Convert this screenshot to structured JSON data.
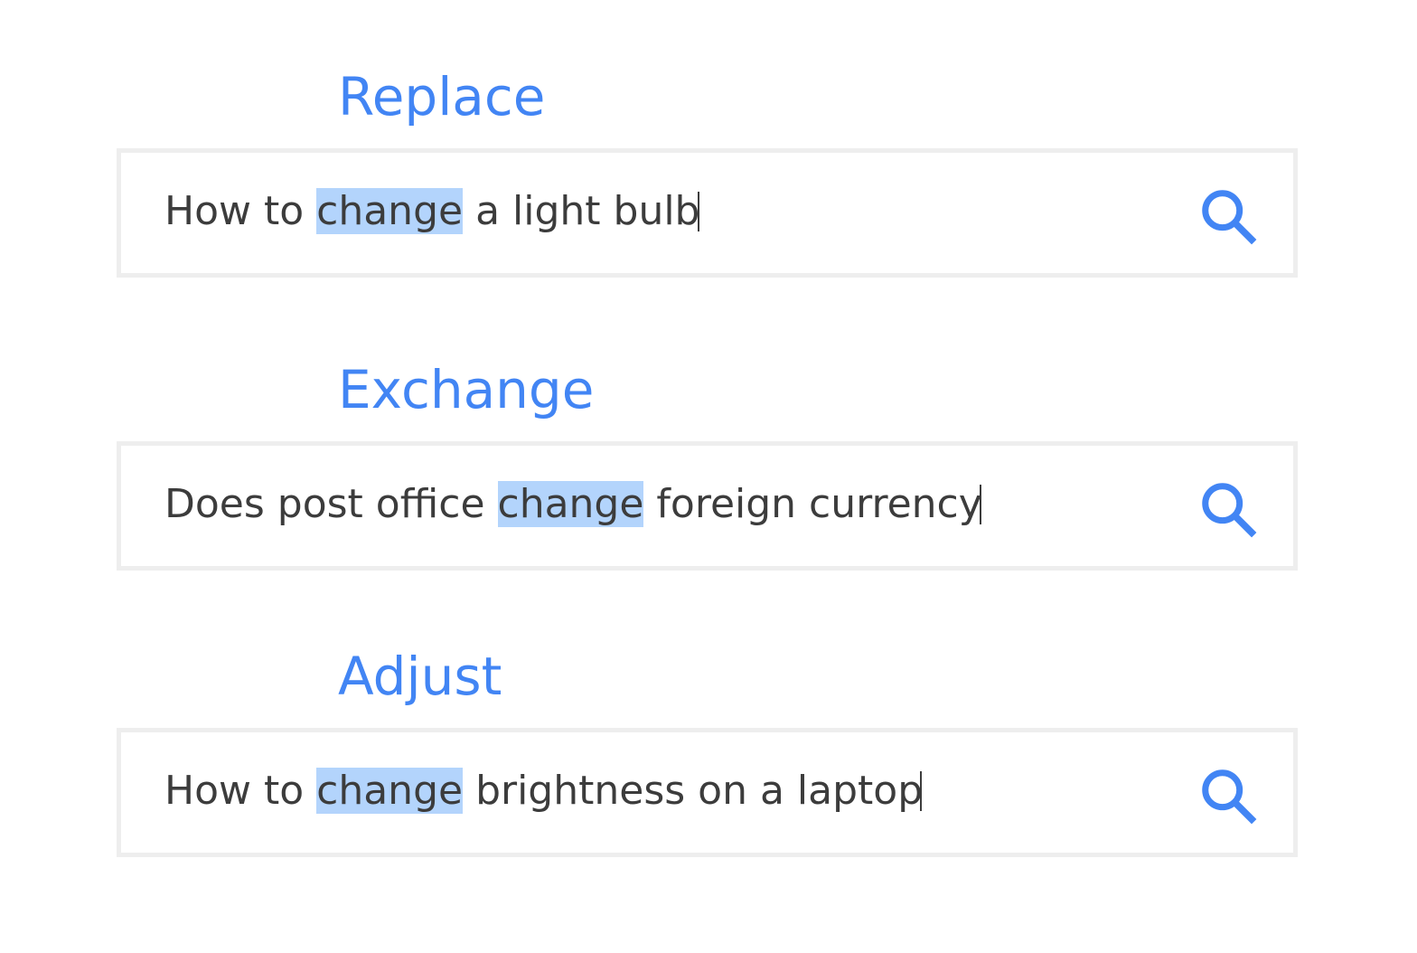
{
  "accent_color": "#4285f4",
  "highlight_color": "#b3d4fc",
  "sections": [
    {
      "heading": "Replace",
      "query": {
        "before": "How to ",
        "highlight": "change",
        "after": " a light bulb"
      },
      "icon": "search-icon"
    },
    {
      "heading": "Exchange",
      "query": {
        "before": "Does post office ",
        "highlight": "change",
        "after": " foreign currency"
      },
      "icon": "search-icon"
    },
    {
      "heading": "Adjust",
      "query": {
        "before": "How to ",
        "highlight": "change",
        "after": " brightness on a laptop"
      },
      "icon": "search-icon"
    }
  ]
}
